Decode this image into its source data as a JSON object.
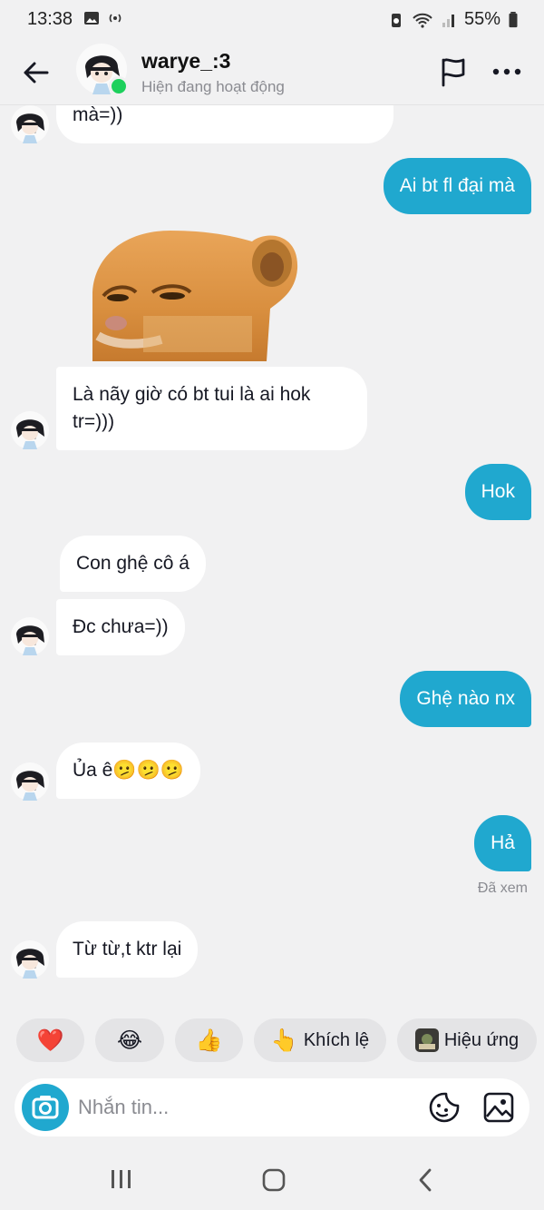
{
  "status_bar": {
    "time": "13:38",
    "battery": "55%"
  },
  "header": {
    "name": "warye_:3",
    "status": "Hiện đang hoạt động"
  },
  "messages": [
    {
      "text": "mà=))"
    },
    {
      "text": "Ai bt fl đại mà"
    },
    {
      "text": "Là nãy giờ có bt tui là ai hok tr=)))"
    },
    {
      "text": "Hok"
    },
    {
      "text": "Con ghệ cô á"
    },
    {
      "text": "Đc chưa=))"
    },
    {
      "text": "Ghệ nào nx"
    },
    {
      "text": "Ủa ê🫤🫤🫤"
    },
    {
      "text": "Hả"
    },
    {
      "text": "Từ từ,t ktr lại"
    }
  ],
  "seen_label": "Đã xem",
  "quick_reactions": {
    "heart": "❤️",
    "laugh": "😂",
    "thumbs": "👍",
    "nudge_emoji": "👆",
    "nudge_label": "Khích lệ",
    "effects_label": "Hiệu ứng"
  },
  "composer": {
    "placeholder": "Nhắn tin..."
  },
  "colors": {
    "accent": "#20a8cf",
    "online": "#1dd05c",
    "background": "#f1f1f2"
  }
}
